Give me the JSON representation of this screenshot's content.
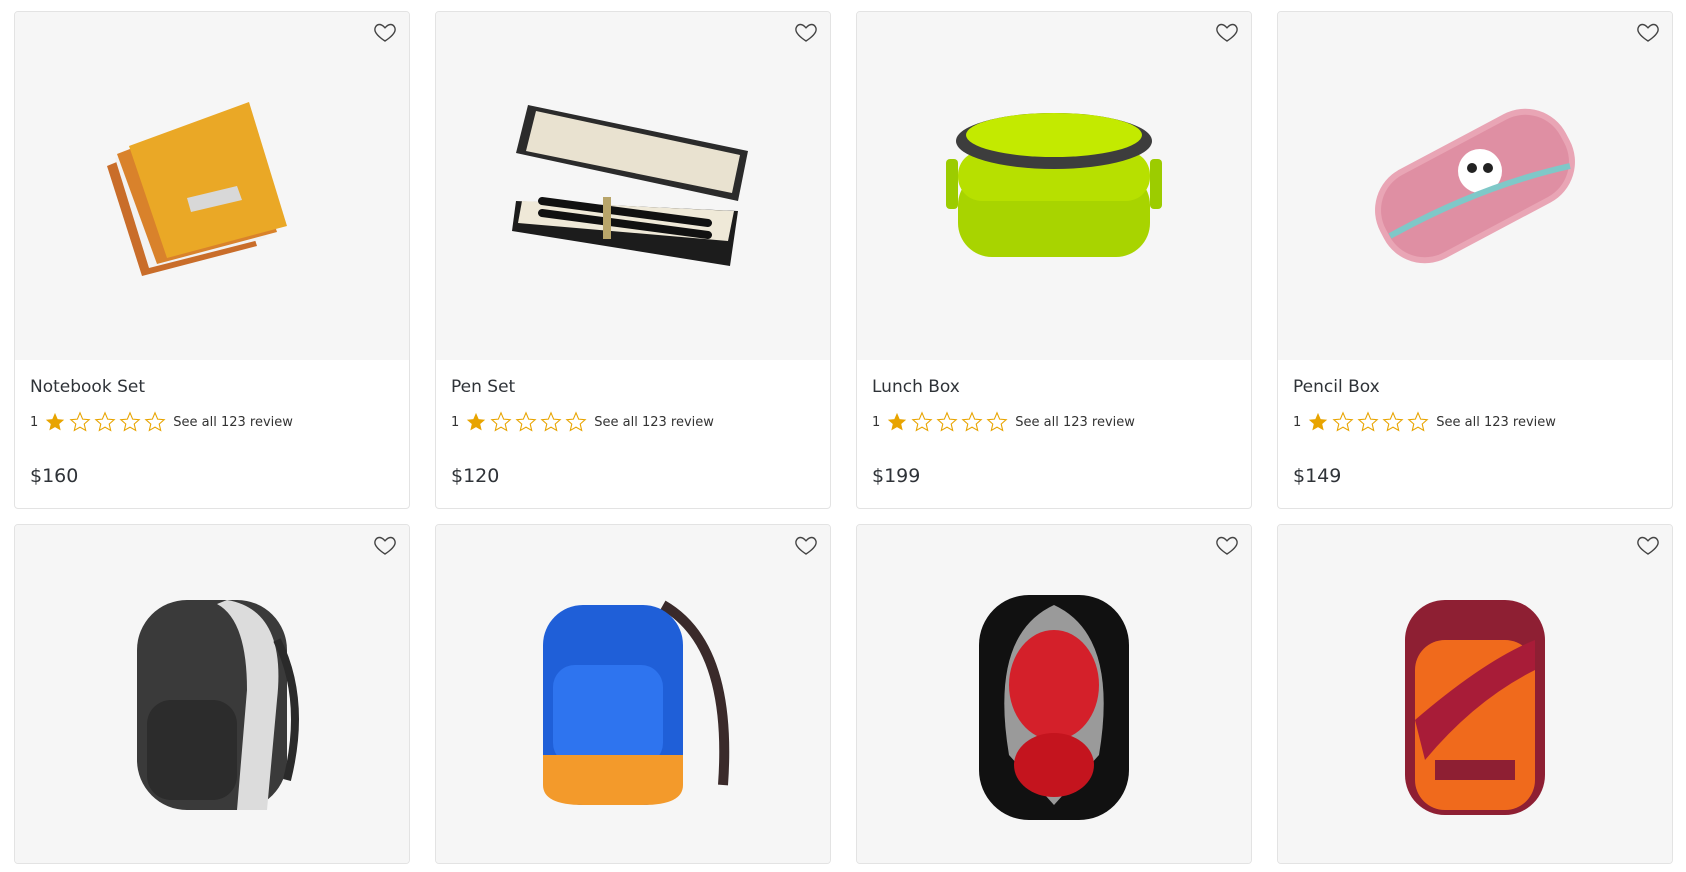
{
  "accent_star": "#e8a400",
  "products": [
    {
      "name": "Notebook Set",
      "rating": "1",
      "review_text": "See all 123 review",
      "price": "$160",
      "image": "notebook-image"
    },
    {
      "name": "Pen Set",
      "rating": "1",
      "review_text": "See all 123 review",
      "price": "$120",
      "image": "pen-set-image"
    },
    {
      "name": "Lunch Box",
      "rating": "1",
      "review_text": "See all 123 review",
      "price": "$199",
      "image": "lunch-box-image"
    },
    {
      "name": "Pencil Box",
      "rating": "1",
      "review_text": "See all 123 review",
      "price": "$149",
      "image": "pencil-box-image"
    }
  ],
  "products_row2": [
    {
      "image": "gray-backpack-image"
    },
    {
      "image": "blue-backpack-image"
    },
    {
      "image": "red-black-backpack-image"
    },
    {
      "image": "orange-backpack-image"
    }
  ],
  "icons": {
    "wishlist": "heart-outline-icon",
    "star_filled": "star-filled-icon",
    "star_empty": "star-outline-icon"
  }
}
